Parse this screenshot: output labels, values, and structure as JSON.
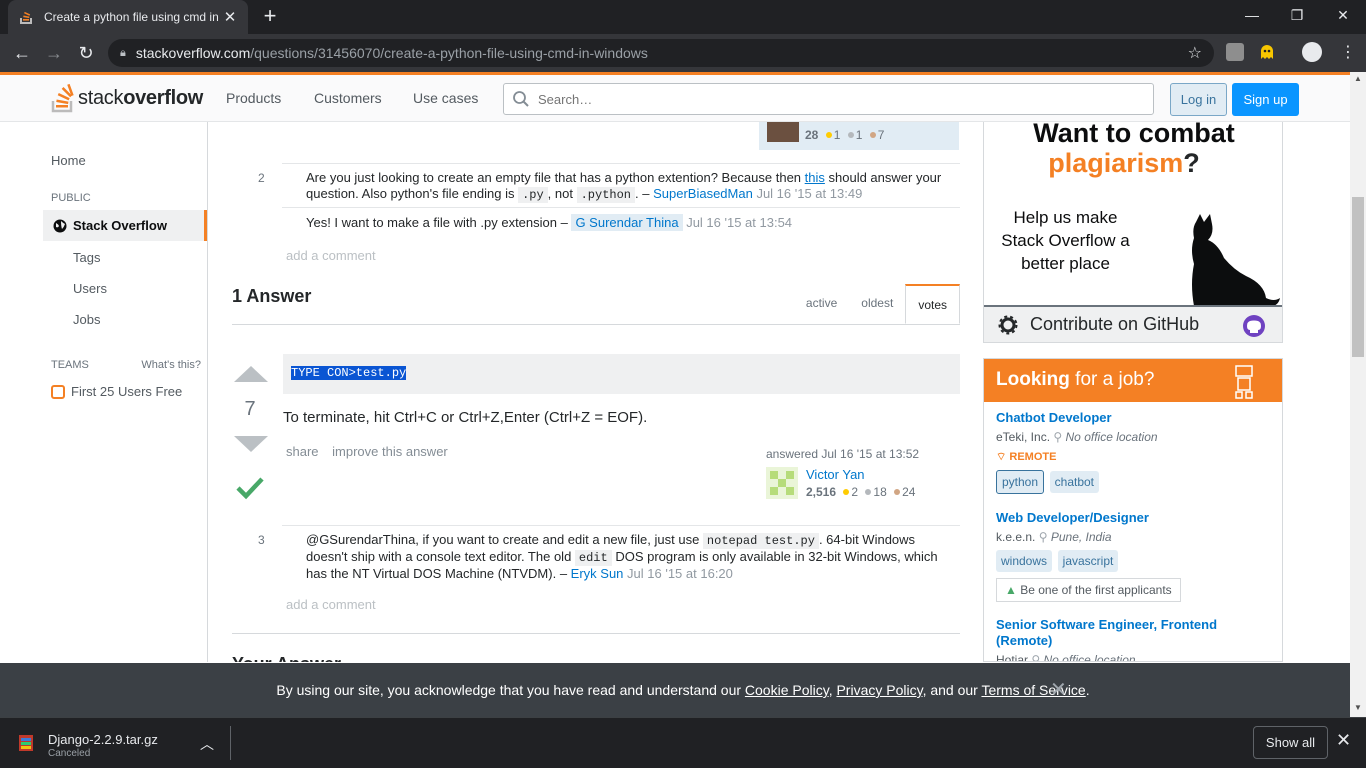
{
  "browser": {
    "tab_title": "Create a python file using cmd in",
    "tab_close": "✕",
    "new_tab": "+",
    "url_host": "stackoverflow.com",
    "url_path": "/questions/31456070/create-a-python-file-using-cmd-in-windows",
    "win_minimize": "—",
    "win_restore": "❐",
    "win_close": "✕"
  },
  "so_header": {
    "logo_regular": "stack",
    "logo_bold": "overflow",
    "nav": [
      "Products",
      "Customers",
      "Use cases"
    ],
    "search_placeholder": "Search…",
    "login": "Log in",
    "signup": "Sign up"
  },
  "leftnav": {
    "home": "Home",
    "public": "PUBLIC",
    "stack_overflow": "Stack Overflow",
    "tags": "Tags",
    "users": "Users",
    "jobs": "Jobs",
    "teams": "TEAMS",
    "whats_this": "What's this?",
    "first_users": "First 25 Users Free"
  },
  "question_user": {
    "rep": "28",
    "gold": "1",
    "silver": "1",
    "bronze": "7"
  },
  "comments_q": [
    {
      "score": "2",
      "t1": "Are you just looking to create an empty file that has a python extention? Because then ",
      "link": "this",
      "t2": " should answer your question. Also python's file ending is ",
      "code1": ".py",
      "t3": ", not ",
      "code2": ".python",
      "t4": ". – ",
      "user": "SuperBiasedMan",
      "date": "Jul 16 '15 at 13:49"
    },
    {
      "text": "Yes! I want to make a file with .py extension – ",
      "user": "G Surendar Thina",
      "date": "Jul 16 '15 at 13:54"
    }
  ],
  "add_comment": "add a comment",
  "answers": {
    "heading": "1 Answer",
    "tabs": [
      "active",
      "oldest",
      "votes"
    ],
    "vote_count": "7",
    "code": "TYPE CON>test.py",
    "text": "To terminate, hit Ctrl+C or Ctrl+Z,Enter (Ctrl+Z = EOF).",
    "share": "share",
    "improve": "improve this answer",
    "answered": "answered Jul 16 '15 at 13:52",
    "user": "Victor Yan",
    "rep": "2,516",
    "gold": "2",
    "silver": "18",
    "bronze": "24"
  },
  "comment_a": {
    "score": "3",
    "t1": "@GSurendarThina, if you want to create and edit a new file, just use ",
    "code1": "notepad test.py",
    "t2": ". 64-bit Windows doesn't ship with a console text editor. The old ",
    "code2": "edit",
    "t3": " DOS program is only available in 32-bit Windows, which has the NT Virtual DOS Machine (NTVDM). – ",
    "user": "Eryk Sun",
    "date": "Jul 16 '15 at 16:20"
  },
  "your_answer": "Your Answer",
  "ad": {
    "line1": "Want to combat",
    "line2": "plagiarism",
    "line2_end": "?",
    "help": "Help us make Stack Overflow a better place",
    "github": "Contribute on GitHub"
  },
  "jobs": {
    "head_bold": "Looking",
    "head_rest": " for a job?",
    "items": [
      {
        "title": "Chatbot Developer",
        "company": "eTeki, Inc.",
        "location": "No office location",
        "remote": "REMOTE",
        "tags": [
          "python",
          "chatbot"
        ]
      },
      {
        "title": "Web Developer/Designer",
        "company": "k.e.e.n.",
        "location": "Pune, India",
        "tags": [
          "windows",
          "javascript"
        ],
        "note": "Be one of the first applicants"
      },
      {
        "title": "Senior Software Engineer, Frontend (Remote)",
        "company": "Hotjar",
        "location": "No office location"
      }
    ]
  },
  "cookie": {
    "t1": "By using our site, you acknowledge that you have read and understand our ",
    "cookie_policy": "Cookie Policy",
    "sep1": ", ",
    "privacy": "Privacy Policy",
    "t2": ", and our ",
    "tos": "Terms of Service",
    "t3": ".",
    "close": "✕"
  },
  "download": {
    "file": "Django-2.2.9.tar.gz",
    "status": "Canceled",
    "show_all": "Show all",
    "close": "✕"
  },
  "colors": {
    "accent": "#f48024",
    "link": "#0077cc",
    "chrome_dark": "#202124"
  }
}
